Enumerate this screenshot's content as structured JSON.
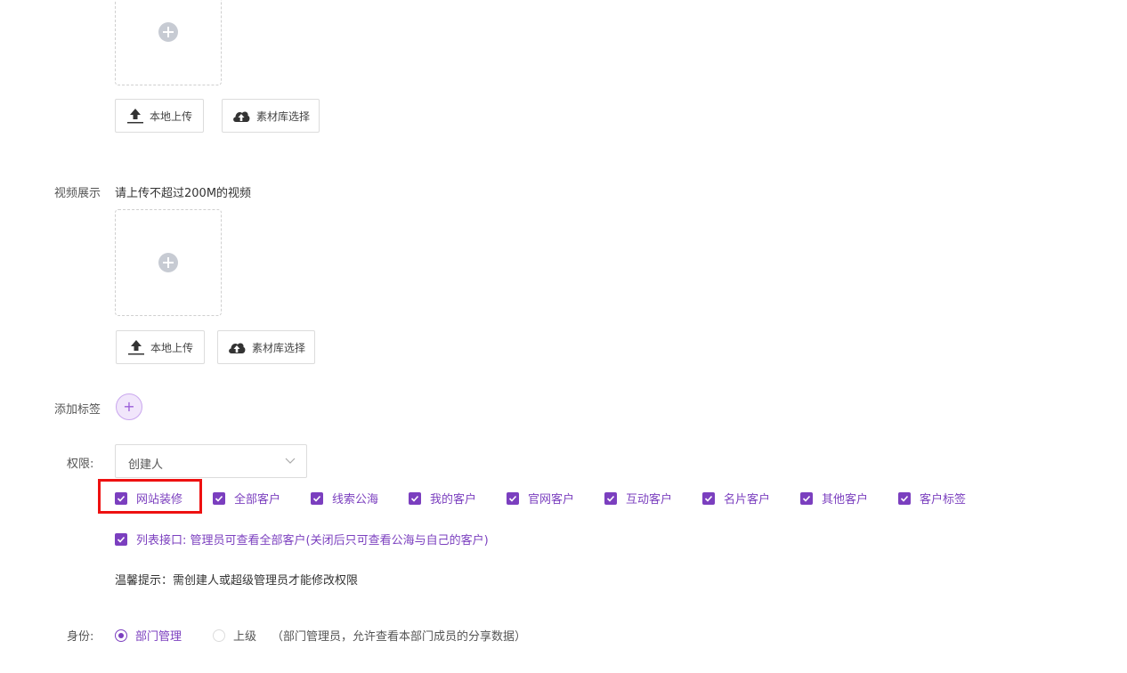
{
  "image_section": {
    "upload_local_label": "本地上传",
    "library_select_label": "素材库选择"
  },
  "video_section": {
    "label": "视频展示",
    "hint": "请上传不超过200M的视频",
    "upload_local_label": "本地上传",
    "library_select_label": "素材库选择"
  },
  "tags_section": {
    "label": "添加标签",
    "add_symbol": "+"
  },
  "permission_section": {
    "label": "权限:",
    "select_value": "创建人",
    "checkboxes": [
      {
        "label": "网站装修",
        "checked": true
      },
      {
        "label": "全部客户",
        "checked": true
      },
      {
        "label": "线索公海",
        "checked": true
      },
      {
        "label": "我的客户",
        "checked": true
      },
      {
        "label": "官网客户",
        "checked": true
      },
      {
        "label": "互动客户",
        "checked": true
      },
      {
        "label": "名片客户",
        "checked": true
      },
      {
        "label": "其他客户",
        "checked": true
      },
      {
        "label": "客户标签",
        "checked": true
      }
    ],
    "list_api_label": "列表接口: 管理员可查看全部客户(关闭后只可查看公海与自己的客户)",
    "tip": "温馨提示：需创建人或超级管理员才能修改权限"
  },
  "identity_section": {
    "label": "身份:",
    "options": [
      {
        "label": "部门管理",
        "selected": true
      },
      {
        "label": "上级",
        "selected": false
      }
    ],
    "note": "（部门管理员，允许查看本部门成员的分享数据）"
  },
  "colors": {
    "accent": "#7b3fbf",
    "highlight": "#ee1111"
  }
}
